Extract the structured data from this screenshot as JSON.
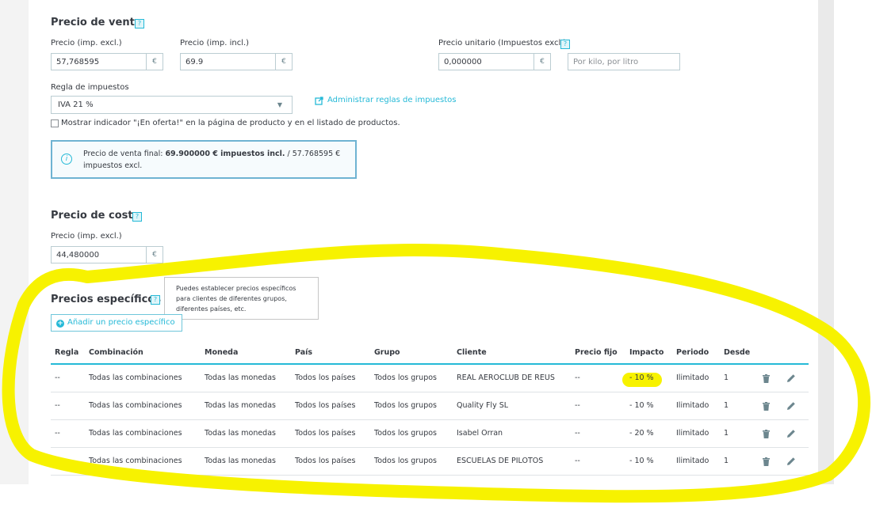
{
  "venta": {
    "title": "Precio de venta",
    "help": "?",
    "excl_label": "Precio (imp. excl.)",
    "excl_value": "57,768595",
    "incl_label": "Precio (imp. incl.)",
    "incl_value": "69.9",
    "currency": "€",
    "unit_label": "Precio unitario (Impuestos excl.)",
    "unit_value": "0,000000",
    "unit_placeholder": "Por kilo, por litro",
    "tax_rule_label": "Regla de impuestos",
    "tax_rule_value": "IVA 21 %",
    "tax_manage_link": "Administrar reglas de impuestos",
    "on_sale_label": "Mostrar indicador \"¡En oferta!\" en la página de producto y en el listado de productos.",
    "final_prefix": "Precio de venta final: ",
    "final_incl": "69.900000 € impuestos incl.",
    "final_sep": " / 57.768595 €",
    "final_excl": "impuestos excl."
  },
  "coste": {
    "title": "Precio de coste",
    "help": "?",
    "label": "Precio (imp. excl.)",
    "value": "44,480000",
    "currency": "€"
  },
  "especificos": {
    "title": "Precios específicos",
    "help": "?",
    "tooltip_1": "Puedes establecer precios específicos",
    "tooltip_2": "para clientes de diferentes grupos,",
    "tooltip_3": "diferentes países, etc.",
    "add_button": "Añadir un precio específico",
    "columns": [
      "Regla",
      "Combinación",
      "Moneda",
      "País",
      "Grupo",
      "Cliente",
      "Precio fijo",
      "Impacto",
      "Periodo",
      "Desde"
    ],
    "rows": [
      {
        "regla": "--",
        "combinacion": "Todas las combinaciones",
        "moneda": "Todas las monedas",
        "pais": "Todos los países",
        "grupo": "Todos los grupos",
        "cliente": "REAL AEROCLUB DE REUS",
        "fijo": "--",
        "impacto": "- 10 %",
        "periodo": "Ilimitado",
        "desde": "1"
      },
      {
        "regla": "--",
        "combinacion": "Todas las combinaciones",
        "moneda": "Todas las monedas",
        "pais": "Todos los países",
        "grupo": "Todos los grupos",
        "cliente": "Quality Fly SL",
        "fijo": "--",
        "impacto": "- 10 %",
        "periodo": "Ilimitado",
        "desde": "1"
      },
      {
        "regla": "--",
        "combinacion": "Todas las combinaciones",
        "moneda": "Todas las monedas",
        "pais": "Todos los países",
        "grupo": "Todos los grupos",
        "cliente": "Isabel Orran",
        "fijo": "--",
        "impacto": "- 20 %",
        "periodo": "Ilimitado",
        "desde": "1"
      },
      {
        "regla": "--",
        "combinacion": "Todas las combinaciones",
        "moneda": "Todas las monedas",
        "pais": "Todos los países",
        "grupo": "Todos los grupos",
        "cliente": "ESCUELAS DE PILOTOS",
        "fijo": "--",
        "impacto": "- 10 %",
        "periodo": "Ilimitado",
        "desde": "1"
      }
    ]
  },
  "icons": {
    "help": "question-icon",
    "info": "info-icon",
    "add": "plus-circle-icon",
    "delete": "trash-icon",
    "edit": "pencil-icon"
  },
  "colors": {
    "accent": "#25b9d7",
    "text": "#363a41",
    "annotation": "#f7f200"
  }
}
